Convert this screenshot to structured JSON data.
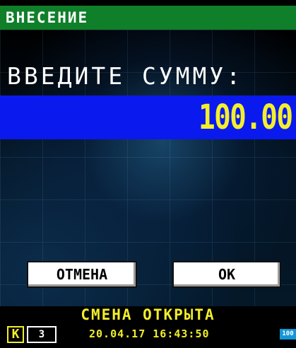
{
  "window": {
    "title": "ВНЕСЕНИЕ"
  },
  "main": {
    "prompt": "ВВЕДИТЕ СУММУ:",
    "amount": "100.00"
  },
  "buttons": {
    "cancel_label": "ОТМЕНА",
    "ok_label": "OK"
  },
  "status": {
    "shift_text": "СМЕНА ОТКРЫТА",
    "k_label": "K",
    "shift_number": "3",
    "datetime": "20.04.17 16:43:50",
    "battery_label": "100"
  },
  "colors": {
    "title_bg": "#0f7f2a",
    "amount_bg": "#0a19ee",
    "amount_text": "#f3ef2c",
    "status_text": "#f1ee2b",
    "battery_bg": "#1496d8"
  }
}
